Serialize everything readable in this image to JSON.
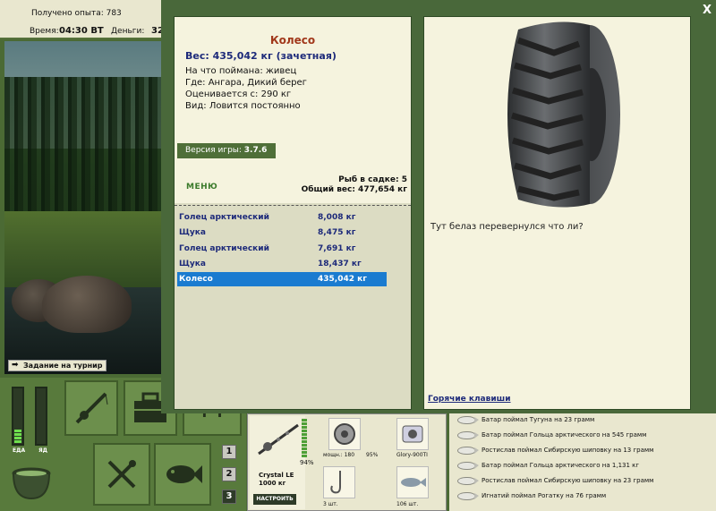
{
  "topbar": {
    "experience": "Получено опыта: 783",
    "time_label": "Время:",
    "time_value": "04:30 ВТ",
    "money_label": "Деньги:",
    "money_value": "32"
  },
  "scene": {
    "tournament_button": "Задание на турнир"
  },
  "meters": {
    "food_label": "ЕДА",
    "poison_label": "ЯД",
    "food_level": 0.25,
    "poison_level": 0
  },
  "bottom_left": {
    "num_buttons": [
      "1",
      "2",
      "3"
    ]
  },
  "tackle": {
    "rod_name": "Crystal LE",
    "rod_weight": "1000 кг",
    "rod_percent": "94%",
    "setup_button": "НАСТРОИТЬ",
    "reel_power": "мощн.: 180",
    "reel_percent": "95%",
    "line_name": "Glory-900TI",
    "hook_count": "3 шт.",
    "bait_count": "106 шт."
  },
  "feed": [
    "Батар поймал Тугуна на 23 грамм",
    "Батар поймал Гольца арктического на 545 грамм",
    "Ростислав поймал Сибирскую шиповку на 13 грамм",
    "Батар поймал Гольца арктического на 1,131 кг",
    "Ростислав поймал Сибирскую шиповку на 23 грамм",
    "Игнатий поймал Рогатку на 76 грамм"
  ],
  "modal": {
    "close_label": "X",
    "fish_name": "Колесо",
    "fish_weight": "Вес: 435,042 кг (зачетная)",
    "caught_on": "На что поймана: живец",
    "where": "Где: Ангара, Дикий берег",
    "valued_from": "Оценивается с: 290 кг",
    "kind": "Вид: Ловится постоянно",
    "version_label": "Версия игры: ",
    "version_value": "3.7.6",
    "menu_label": "МЕНЮ",
    "keep_count": "Рыб в садке: 5",
    "keep_weight": "Общий вес: 477,654 кг",
    "catch_list": [
      {
        "name": "Голец арктический",
        "weight": "8,008 кг",
        "selected": false
      },
      {
        "name": "Щука",
        "weight": "8,475 кг",
        "selected": false
      },
      {
        "name": "Голец арктический",
        "weight": "7,691 кг",
        "selected": false
      },
      {
        "name": "Щука",
        "weight": "18,437 кг",
        "selected": false
      },
      {
        "name": "Колесо",
        "weight": "435,042 кг",
        "selected": true
      }
    ],
    "comment": "Тут белаз перевернулся что ли?",
    "hotkeys": "Горячие клавиши"
  },
  "colors": {
    "frame_green": "#49683a",
    "panel_cream": "#f5f3de",
    "title_red": "#a1381b",
    "text_navy": "#1d2a7a",
    "selection_blue": "#1a7bd0"
  },
  "icons": [
    "rod-icon",
    "tackle-box-icon",
    "fork-knife-icon",
    "fish-icon",
    "cauldron-icon",
    "tire-image"
  ]
}
